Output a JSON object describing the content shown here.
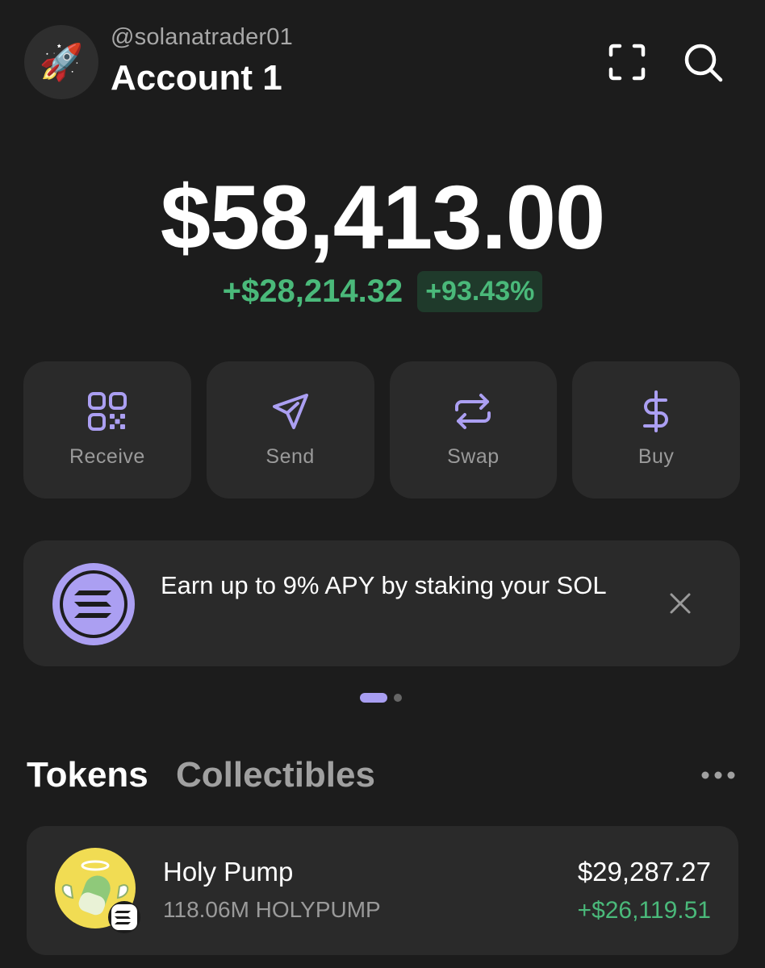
{
  "header": {
    "avatar_emoji": "🚀",
    "username": "@solanatrader01",
    "account_name": "Account 1",
    "scan_icon": "scan-icon",
    "search_icon": "search-icon"
  },
  "balance": {
    "total": "$58,413.00",
    "change_amount": "+$28,214.32",
    "change_percent": "+93.43%"
  },
  "actions": [
    {
      "label": "Receive",
      "icon": "qr-code-icon"
    },
    {
      "label": "Send",
      "icon": "send-icon"
    },
    {
      "label": "Swap",
      "icon": "swap-icon"
    },
    {
      "label": "Buy",
      "icon": "dollar-icon"
    }
  ],
  "promo": {
    "text": "Earn up to 9% APY by staking your SOL",
    "icon": "solana-logo-icon",
    "close_icon": "close-icon"
  },
  "pager": {
    "pages": 2,
    "active": 1
  },
  "tabs": {
    "tokens": "Tokens",
    "collectibles": "Collectibles",
    "more_icon": "more-horizontal-icon"
  },
  "tokens": [
    {
      "name": "Holy Pump",
      "amount": "118.06M HOLYPUMP",
      "value": "$29,287.27",
      "change": "+$26,119.51"
    }
  ],
  "colors": {
    "background": "#1c1c1c",
    "card": "#2a2a2a",
    "accent": "#ab9ff2",
    "positive": "#4ab97a"
  }
}
